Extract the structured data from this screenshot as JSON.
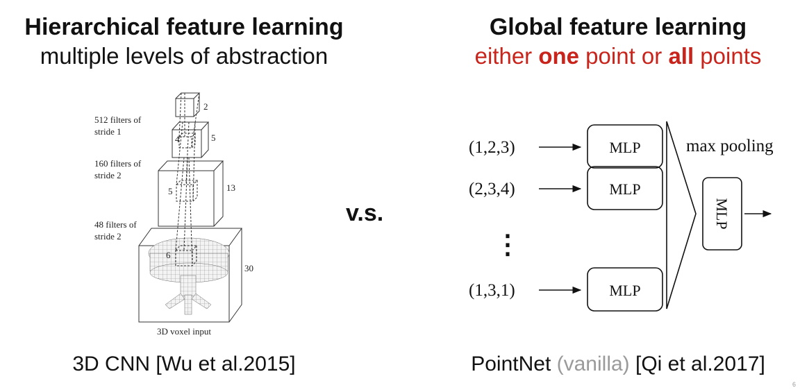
{
  "left": {
    "title": "Hierarchical feature learning",
    "subtitle": "multiple levels of abstraction",
    "caption": "3D CNN [Wu et al.2015]",
    "figure": {
      "layer_labels": [
        {
          "line1": "512 filters of",
          "line2": "stride 1"
        },
        {
          "line1": "160 filters of",
          "line2": "stride 2"
        },
        {
          "line1": "48 filters of",
          "line2": "stride 2"
        }
      ],
      "sizes": [
        "2",
        "5",
        "4",
        "13",
        "5",
        "30",
        "6"
      ],
      "input_label": "3D voxel input"
    }
  },
  "vs_label": "v.s.",
  "right": {
    "title": "Global feature learning",
    "subtitle_parts": {
      "pre": "either ",
      "one": "one",
      "mid": " point or ",
      "all": "all",
      "post": " points"
    },
    "caption_parts": {
      "pre": "PointNet ",
      "vanilla": "(vanilla)",
      "post": " [Qi et al.2017]"
    },
    "figure": {
      "points": [
        "(1,2,3)",
        "(2,3,4)",
        "(1,3,1)"
      ],
      "ellipsis": "⋮",
      "mlp_label": "MLP",
      "pool_label": "max pooling",
      "final_mlp_label": "MLP"
    }
  },
  "colors": {
    "accent": "#c8241c",
    "muted": "#9a9a9a",
    "text": "#111111"
  },
  "corner_mark": "6"
}
